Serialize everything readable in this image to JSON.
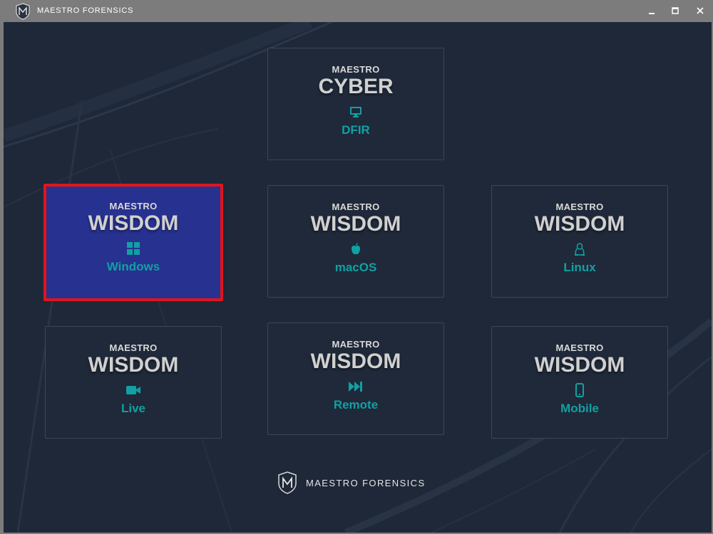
{
  "window": {
    "title": "MAESTRO FORENSICS",
    "minimize_glyph": "–",
    "maximize_glyph": "□",
    "close_glyph": "✕"
  },
  "cards": [
    {
      "brand": "MAESTRO",
      "product": "CYBER",
      "variant": "DFIR",
      "icon": "monitor-icon",
      "selected": false
    },
    {
      "brand": "MAESTRO",
      "product": "WISDOM",
      "variant": "Windows",
      "icon": "windows-icon",
      "selected": true
    },
    {
      "brand": "MAESTRO",
      "product": "WISDOM",
      "variant": "macOS",
      "icon": "apple-icon",
      "selected": false
    },
    {
      "brand": "MAESTRO",
      "product": "WISDOM",
      "variant": "Linux",
      "icon": "linux-icon",
      "selected": false
    },
    {
      "brand": "MAESTRO",
      "product": "WISDOM",
      "variant": "Live",
      "icon": "video-camera-icon",
      "selected": false
    },
    {
      "brand": "MAESTRO",
      "product": "WISDOM",
      "variant": "Remote",
      "icon": "fast-forward-icon",
      "selected": false
    },
    {
      "brand": "MAESTRO",
      "product": "WISDOM",
      "variant": "Mobile",
      "icon": "mobile-phone-icon",
      "selected": false
    }
  ],
  "footer": {
    "text": "MAESTRO FORENSICS"
  },
  "colors": {
    "background": "#1e2838",
    "titlebar": "#7c7c7c",
    "card_border": "#3a4557",
    "selected_card": "#27318f",
    "selected_border": "#e3141b",
    "accent_teal": "#11a0a3",
    "product_text": "#d0d0d0"
  }
}
